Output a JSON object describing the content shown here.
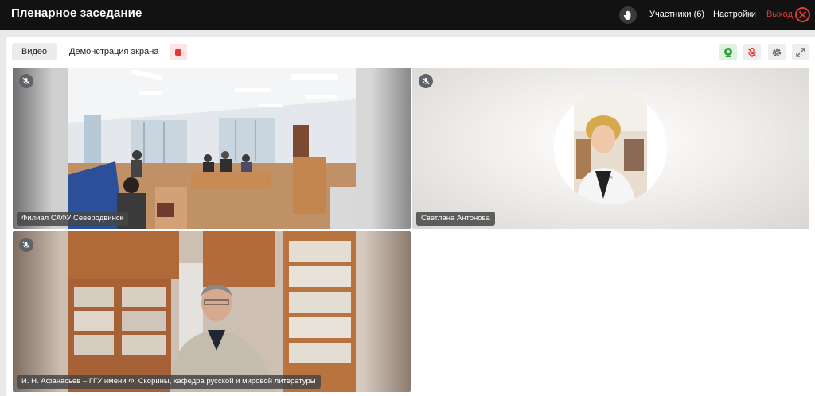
{
  "header": {
    "title": "Пленарное заседание",
    "participants_label": "Участники (6)",
    "settings_label": "Настройки",
    "exit_label": "Выход"
  },
  "toolbar": {
    "tab_video": "Видео",
    "tab_screen": "Демонстрация экрана"
  },
  "tiles": [
    {
      "name": "Филиал САФУ Северодвинск",
      "muted": true
    },
    {
      "name": "Светлана Антонова",
      "muted": true
    },
    {
      "name": "И. Н. Афанасьев – ГГУ имени Ф. Скорины, кафедра русской и мировой литературы",
      "muted": true
    }
  ],
  "colors": {
    "header_bg": "#121212",
    "exit_red": "#e53935",
    "camera_green": "#2e9d3a"
  }
}
